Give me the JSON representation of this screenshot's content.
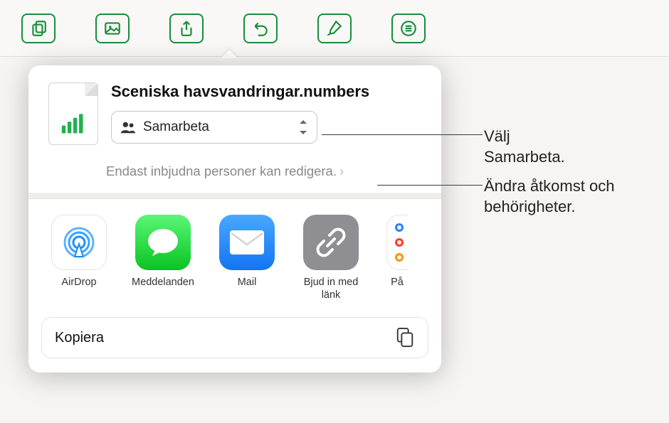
{
  "document": {
    "title": "Sceniska havsvandringar.numbers"
  },
  "collab": {
    "mode_label": "Samarbeta",
    "permission_text": "Endast inbjudna personer kan redigera."
  },
  "share_targets": [
    {
      "id": "airdrop",
      "label": "AirDrop"
    },
    {
      "id": "messages",
      "label": "Meddelanden"
    },
    {
      "id": "mail",
      "label": "Mail"
    },
    {
      "id": "link",
      "label": "Bjud in med länk"
    },
    {
      "id": "reminders",
      "label": "På"
    }
  ],
  "actions": {
    "copy_label": "Kopiera"
  },
  "callouts": {
    "choose_collab": "Välj Samarbeta.",
    "change_access": "Ändra åtkomst och behörigheter."
  },
  "colors": {
    "accent": "#1a8d3e"
  }
}
